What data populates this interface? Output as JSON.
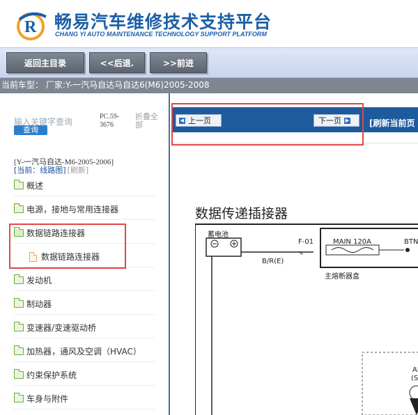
{
  "header": {
    "title": "畅易汽车维修技术支持平台",
    "subtitle": "CHANG YI AUTO MAINTENANCE TECHNOLOGY SUPPORT PLATFORM",
    "brand_color": "#1b5fa8",
    "logo_icon": "logo-icon"
  },
  "nav": {
    "home_label": "返回主目录",
    "back_label": "<<后退.",
    "forward_label": ">>前进"
  },
  "model_bar": {
    "text": "当前车型：  厂家:Y-一汽马自达马自达6(M6)2005-2008"
  },
  "sidebar": {
    "search_placeholder": "输入关键字查询",
    "search_button": "查询",
    "pc_code": "PC.59-3676",
    "collapse_all": "折叠全部",
    "model_path": "[Y-一汽马自达-M6-2005-2006]",
    "current_label": "[当前：线路图]",
    "refresh_label": "[刷新]",
    "items": [
      {
        "label": "概述"
      },
      {
        "label": "电源，接地与常用连接器"
      },
      {
        "label": "数据链路连接器"
      },
      {
        "label": "数据链路连接器"
      },
      {
        "label": "发动机"
      },
      {
        "label": "制动器"
      },
      {
        "label": "变速器/变速驱动桥"
      },
      {
        "label": "加热器，通风及空调（HVAC）"
      },
      {
        "label": "约束保护系统"
      },
      {
        "label": "车身与附件"
      }
    ]
  },
  "viewer": {
    "prev_page": "上一页",
    "next_page": "下一页",
    "refresh_page": "[刷新当前页",
    "diagram_title": "数据传递插接器",
    "labels": {
      "battery": "蓄电池",
      "fuse_id": "F-01",
      "fuse_main": "MAIN 120A",
      "fuse_btn": "BTN",
      "wire": "B/R(E)",
      "fuse_box": "主熔断器盒",
      "ab": "AB",
      "s": "(S"
    },
    "highlight_color": "#e24545",
    "toolbar_color": "#1d5b9c"
  }
}
